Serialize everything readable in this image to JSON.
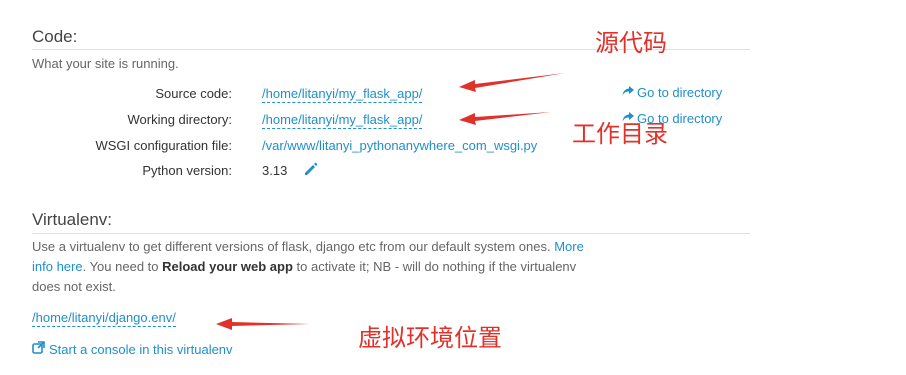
{
  "code": {
    "heading": "Code:",
    "subtitle": "What your site is running.",
    "rows": [
      {
        "label": "Source code:",
        "value": "/home/litanyi/my_flask_app/",
        "action": "Go to directory"
      },
      {
        "label": "Working directory:",
        "value": "/home/litanyi/my_flask_app/",
        "action": "Go to directory"
      },
      {
        "label": "WSGI configuration file:",
        "value": "/var/www/litanyi_pythonanywhere_com_wsgi.py"
      },
      {
        "label": "Python version:",
        "value": "3.13"
      }
    ]
  },
  "virtualenv": {
    "heading": "Virtualenv:",
    "desc_part1": "Use a virtualenv to get different versions of flask, django etc from our default system ones.",
    "more_info": "More info here",
    "desc_part2": ". You need to",
    "reload_bold": "Reload your web app",
    "desc_part3": "to activate it; NB - will do nothing if the virtualenv does not exist.",
    "path": "/home/litanyi/django.env/",
    "console_link": "Start a console in this virtualenv"
  },
  "annotations": {
    "source": "源代码",
    "workdir": "工作目录",
    "venv": "虚拟环境位置",
    "color": "#e0322a"
  },
  "colors": {
    "link": "#1f8fc9",
    "rule": "#cfe6ef"
  }
}
